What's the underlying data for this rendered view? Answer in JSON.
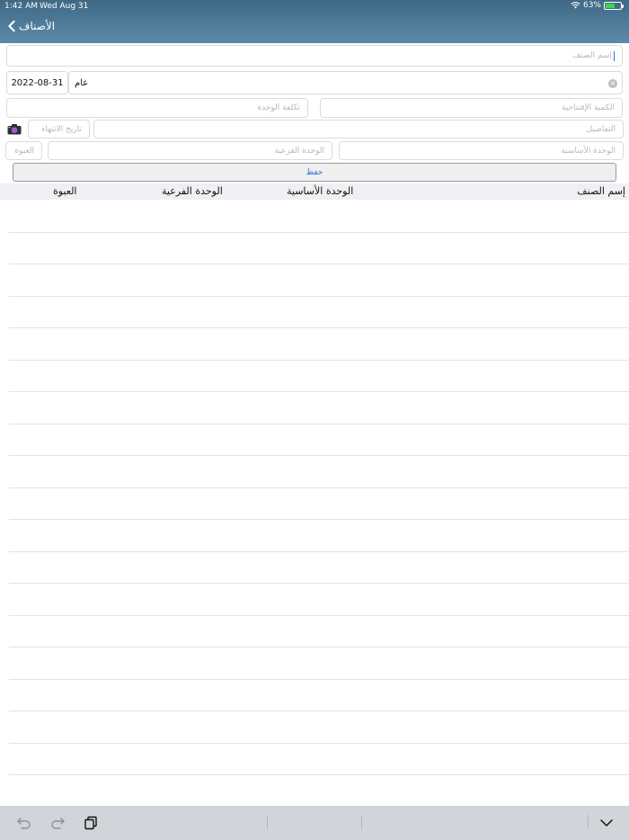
{
  "status_bar": {
    "time": "1:42 AM",
    "date": "Wed Aug 31",
    "battery": "63%",
    "battery_level": 0.63,
    "wifi_icon": "wifi-icon"
  },
  "nav": {
    "back_label": "الأصناف",
    "back_icon": "chevron-left-icon"
  },
  "form": {
    "item_name_placeholder": "إسم الصنف",
    "date_value": "2022-08-31",
    "type_value": "عام",
    "unit_cost_placeholder": "تكلفة الوحدة",
    "opening_qty_placeholder": "الكمية الإفتتاحية",
    "expiry_date_placeholder": "تاريخ الانتهاء",
    "details_placeholder": "التفاصيل",
    "package_placeholder": "العبوة",
    "sub_unit_placeholder": "الوحدة الفرعية",
    "base_unit_placeholder": "الوحدة الأساسية",
    "save_label": "حفظ"
  },
  "table": {
    "headers": {
      "item_name": "إسم الصنف",
      "base_unit": "الوحدة الأساسية",
      "sub_unit": "الوحدة الفرعية",
      "package": "العبوة"
    },
    "rows": []
  },
  "toolbar": {
    "undo_icon": "undo-icon",
    "redo_icon": "redo-icon",
    "paste_icon": "clipboard-icon",
    "dismiss_icon": "chevron-down-icon"
  },
  "colors": {
    "nav_bar": "#4a7896",
    "accent": "#2e6ddf",
    "toolbar": "#d1d4d9"
  }
}
